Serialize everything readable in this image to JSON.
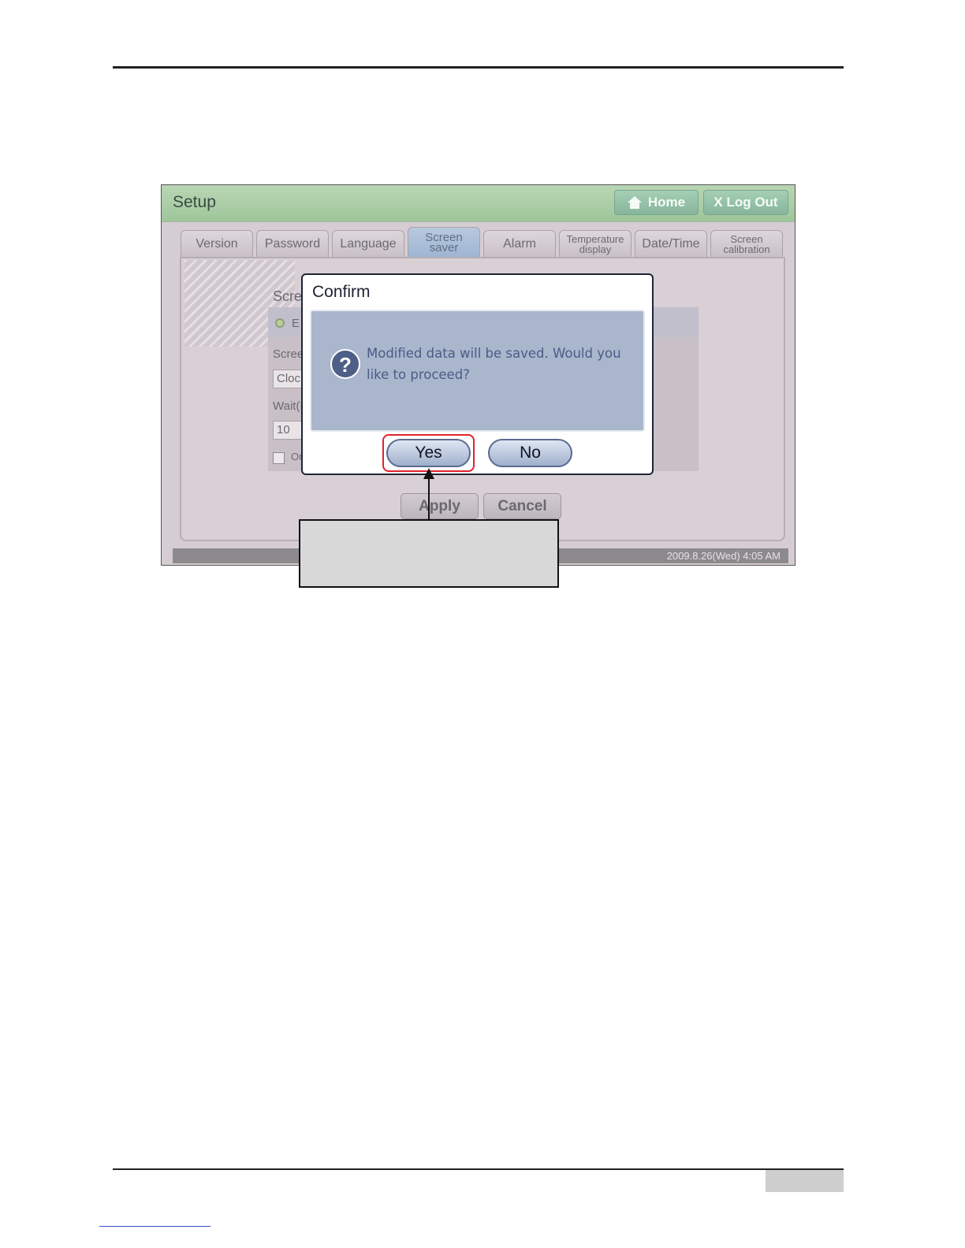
{
  "app": {
    "title": "Setup",
    "home_label": "Home",
    "logout_label": "X Log Out"
  },
  "tabs": [
    {
      "label": "Version"
    },
    {
      "label": "Password"
    },
    {
      "label": "Language"
    },
    {
      "label": "Screen\nsaver",
      "active": true
    },
    {
      "label": "Alarm"
    },
    {
      "label": "Temperature\ndisplay"
    },
    {
      "label": "Date/Time"
    },
    {
      "label": "Screen\ncalibration"
    }
  ],
  "background_panel": {
    "section_fragment": "Scre",
    "radio_fragment": "E",
    "screen_fragment": "Scree",
    "select_fragment": "Clock",
    "wait_fragment": "Wait(M",
    "wait_value": "10",
    "checkbox_fragment": "On"
  },
  "actions": {
    "apply_label": "Apply",
    "cancel_label": "Cancel"
  },
  "status": {
    "clock": "2009.8.26(Wed)  4:05 AM"
  },
  "dialog": {
    "title": "Confirm",
    "icon": "question-icon",
    "message_line1": "Modified data will be saved.  Would you",
    "message_line2": "like to proceed?",
    "yes_label": "Yes",
    "no_label": "No"
  },
  "colors": {
    "highlight": "#e0232c",
    "titlebar": "#a8ceA4",
    "dialog_body": "#a9b6cc"
  }
}
